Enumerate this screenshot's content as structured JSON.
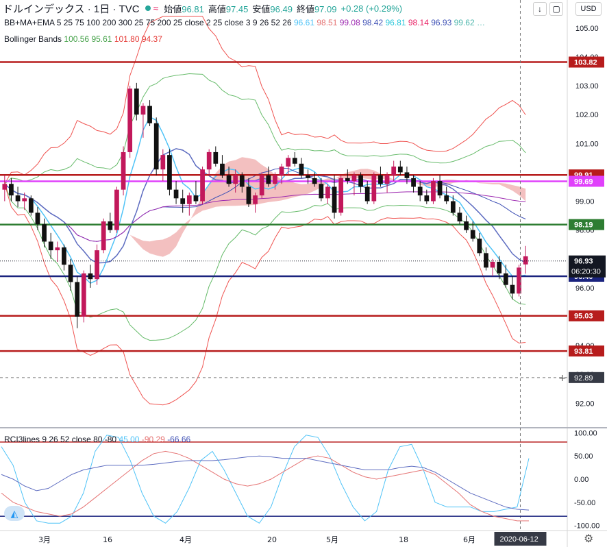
{
  "header": {
    "symbol": "ドルインデックス · 1日 · TVC",
    "ohlc": [
      {
        "label": "始値",
        "value": "96.81"
      },
      {
        "label": "高値",
        "value": "97.45"
      },
      {
        "label": "安値",
        "value": "96.49"
      },
      {
        "label": "終値",
        "value": "97.09"
      }
    ],
    "change": "+0.28 (+0.29%)",
    "currency": "USD"
  },
  "indicators": {
    "bbma": {
      "label": "BB+MA+EMA 5 25 75 100 200 300 25 75 200 25 close 2 25 close 3 9 26 52 26",
      "values": [
        {
          "v": "96.61",
          "color": "#4fc3f7"
        },
        {
          "v": "98.51",
          "color": "#e57373"
        },
        {
          "v": "99.08",
          "color": "#9c27b0"
        },
        {
          "v": "98.42",
          "color": "#3f51b5"
        },
        {
          "v": "96.81",
          "color": "#26c6da"
        },
        {
          "v": "98.14",
          "color": "#e91e63"
        },
        {
          "v": "96.93",
          "color": "#3f51b5"
        },
        {
          "v": "99.62",
          "color": "#4db6ac"
        },
        {
          "v": "…",
          "color": "#4db6ac"
        }
      ]
    },
    "bollinger": {
      "label": "Bollinger Bands",
      "values": [
        {
          "v": "100.56",
          "color": "#43a047"
        },
        {
          "v": "95.61",
          "color": "#43a047"
        },
        {
          "v": "101.80",
          "color": "#e53935"
        },
        {
          "v": "94.37",
          "color": "#e53935"
        }
      ]
    },
    "rci": {
      "label": "RCI3lines 9 26 52 close 80 -80",
      "values": [
        {
          "v": "45.00",
          "color": "#4fc3f7"
        },
        {
          "v": "-90.29",
          "color": "#e57373"
        },
        {
          "v": "-66.66",
          "color": "#3f51b5"
        }
      ]
    }
  },
  "chart_data": {
    "type": "candlestick",
    "price_axis": {
      "ticks": [
        "105.00",
        "104.00",
        "103.00",
        "102.00",
        "101.00",
        "100.00",
        "99.00",
        "98.00",
        "97.00",
        "96.00",
        "95.00",
        "94.00",
        "93.00",
        "92.00"
      ],
      "range": [
        91.2,
        105.4
      ]
    },
    "x_axis": {
      "labels": [
        "3月",
        "16",
        "4月",
        "20",
        "5月",
        "18",
        "6月"
      ],
      "cursor_date": "2020-06-12"
    },
    "horizontal_lines": [
      {
        "value": 103.82,
        "label": "103.82",
        "color": "#b71c1c"
      },
      {
        "value": 99.91,
        "label": "99.91",
        "color": "#b71c1c"
      },
      {
        "value": 99.69,
        "label": "99.69",
        "color": "#e040fb"
      },
      {
        "value": 98.19,
        "label": "98.19",
        "color": "#2e7d32"
      },
      {
        "value": 96.4,
        "label": "96.40",
        "color": "#1a237e"
      },
      {
        "value": 95.03,
        "label": "95.03",
        "color": "#b71c1c"
      },
      {
        "value": 93.81,
        "label": "93.81",
        "color": "#b71c1c"
      }
    ],
    "last_price": {
      "value": 96.93,
      "label": "96.93",
      "countdown": "06:20:30"
    },
    "crosshair_price": {
      "value": 92.89,
      "label": "92.89"
    },
    "candles": [
      [
        99.4,
        99.9,
        99.0,
        99.6
      ],
      [
        99.6,
        99.8,
        99.0,
        99.2
      ],
      [
        99.2,
        99.5,
        98.8,
        99.0
      ],
      [
        99.0,
        99.3,
        98.7,
        99.1
      ],
      [
        99.1,
        99.2,
        98.5,
        98.6
      ],
      [
        98.6,
        98.8,
        98.0,
        98.2
      ],
      [
        98.2,
        98.4,
        97.4,
        97.6
      ],
      [
        97.6,
        97.9,
        97.0,
        97.3
      ],
      [
        97.3,
        97.6,
        96.9,
        97.4
      ],
      [
        97.4,
        97.5,
        96.6,
        96.8
      ],
      [
        96.8,
        97.0,
        95.9,
        96.2
      ],
      [
        96.2,
        96.4,
        94.6,
        95.0
      ],
      [
        95.0,
        96.6,
        94.8,
        96.5
      ],
      [
        96.5,
        96.8,
        96.0,
        96.3
      ],
      [
        96.3,
        97.5,
        96.1,
        97.3
      ],
      [
        97.3,
        98.4,
        97.2,
        98.3
      ],
      [
        98.3,
        98.6,
        97.9,
        98.0
      ],
      [
        98.0,
        99.5,
        97.9,
        99.4
      ],
      [
        99.4,
        100.9,
        99.2,
        100.7
      ],
      [
        100.7,
        103.0,
        100.5,
        102.9
      ],
      [
        102.9,
        103.1,
        101.8,
        102.0
      ],
      [
        102.0,
        102.4,
        101.2,
        102.3
      ],
      [
        102.3,
        102.5,
        101.6,
        101.7
      ],
      [
        101.7,
        101.9,
        99.9,
        100.1
      ],
      [
        100.1,
        100.8,
        99.7,
        100.6
      ],
      [
        100.6,
        100.8,
        99.2,
        99.4
      ],
      [
        99.4,
        99.7,
        98.9,
        99.1
      ],
      [
        99.1,
        99.4,
        98.6,
        98.9
      ],
      [
        98.9,
        99.3,
        98.5,
        99.2
      ],
      [
        99.2,
        99.7,
        98.9,
        99.0
      ],
      [
        99.0,
        100.2,
        98.9,
        100.1
      ],
      [
        100.1,
        100.8,
        99.9,
        100.7
      ],
      [
        100.7,
        100.9,
        100.2,
        100.3
      ],
      [
        100.3,
        100.6,
        99.8,
        99.9
      ],
      [
        99.9,
        100.2,
        99.5,
        99.6
      ],
      [
        99.6,
        100.1,
        99.3,
        99.9
      ],
      [
        99.9,
        100.0,
        99.3,
        99.5
      ],
      [
        99.5,
        99.8,
        98.8,
        98.9
      ],
      [
        98.9,
        99.3,
        98.6,
        99.2
      ],
      [
        99.2,
        100.0,
        99.1,
        99.9
      ],
      [
        99.9,
        100.2,
        99.5,
        99.6
      ],
      [
        99.6,
        100.0,
        99.4,
        99.9
      ],
      [
        99.9,
        100.3,
        99.6,
        100.2
      ],
      [
        100.2,
        100.6,
        99.9,
        100.5
      ],
      [
        100.5,
        100.7,
        100.2,
        100.3
      ],
      [
        100.3,
        100.5,
        99.8,
        99.9
      ],
      [
        99.9,
        100.1,
        99.6,
        99.8
      ],
      [
        99.8,
        100.0,
        99.5,
        99.6
      ],
      [
        99.6,
        99.8,
        99.0,
        99.1
      ],
      [
        99.1,
        99.6,
        98.9,
        99.5
      ],
      [
        99.5,
        99.9,
        98.4,
        98.6
      ],
      [
        98.6,
        99.9,
        98.5,
        99.8
      ],
      [
        99.8,
        100.1,
        99.6,
        99.7
      ],
      [
        99.7,
        100.0,
        99.2,
        99.9
      ],
      [
        99.9,
        100.0,
        99.3,
        99.5
      ],
      [
        99.5,
        99.7,
        98.9,
        99.0
      ],
      [
        99.0,
        100.0,
        98.9,
        99.9
      ],
      [
        99.9,
        100.2,
        99.5,
        99.6
      ],
      [
        99.6,
        100.0,
        99.3,
        99.9
      ],
      [
        99.9,
        100.4,
        99.7,
        100.2
      ],
      [
        100.2,
        100.4,
        99.9,
        100.0
      ],
      [
        100.0,
        100.2,
        99.6,
        99.8
      ],
      [
        99.8,
        99.9,
        99.3,
        99.5
      ],
      [
        99.5,
        99.7,
        99.0,
        99.2
      ],
      [
        99.2,
        99.4,
        98.9,
        99.0
      ],
      [
        99.0,
        99.8,
        98.9,
        99.7
      ],
      [
        99.7,
        99.9,
        99.1,
        99.2
      ],
      [
        99.2,
        99.5,
        98.9,
        99.0
      ],
      [
        99.0,
        99.2,
        98.5,
        98.6
      ],
      [
        98.6,
        98.8,
        98.2,
        98.3
      ],
      [
        98.3,
        98.5,
        97.9,
        98.0
      ],
      [
        98.0,
        98.3,
        97.6,
        97.7
      ],
      [
        97.7,
        97.9,
        97.1,
        97.2
      ],
      [
        97.2,
        97.4,
        96.6,
        96.7
      ],
      [
        96.7,
        97.0,
        96.4,
        96.9
      ],
      [
        96.9,
        97.1,
        96.3,
        96.5
      ],
      [
        96.5,
        96.8,
        96.0,
        96.1
      ],
      [
        96.1,
        96.4,
        95.6,
        95.8
      ],
      [
        95.8,
        96.8,
        95.7,
        96.7
      ],
      [
        96.81,
        97.45,
        96.49,
        97.09
      ]
    ],
    "rci_axis": {
      "ticks": [
        "100.00",
        "50.00",
        "0.00",
        "-50.00",
        "-100.00"
      ],
      "range": [
        -105,
        105
      ]
    },
    "rci_levels": [
      80,
      -80
    ],
    "rci_series": [
      {
        "values": [
          70,
          30,
          -50,
          -90,
          -95,
          -95,
          -80,
          -30,
          60,
          95,
          90,
          40,
          -30,
          -80,
          -95,
          -70,
          -20,
          40,
          60,
          20,
          -30,
          -80,
          -95,
          -60,
          10,
          70,
          95,
          90,
          50,
          -10,
          -60,
          -90,
          -70,
          20,
          70,
          75,
          20,
          -50,
          -60,
          -60,
          -60,
          -70,
          -70,
          -65,
          -60,
          45
        ]
      },
      {
        "values": [
          -30,
          -50,
          -60,
          -70,
          -75,
          -80,
          -75,
          -60,
          -40,
          -20,
          0,
          20,
          40,
          55,
          60,
          55,
          45,
          30,
          15,
          0,
          -10,
          -15,
          -10,
          0,
          15,
          30,
          45,
          50,
          45,
          30,
          15,
          5,
          0,
          5,
          10,
          15,
          20,
          10,
          -10,
          -30,
          -55,
          -70,
          -80,
          -85,
          -90,
          -90
        ]
      },
      {
        "values": [
          10,
          0,
          -15,
          -25,
          -20,
          -5,
          10,
          20,
          25,
          30,
          30,
          30,
          30,
          32,
          35,
          38,
          40,
          40,
          40,
          42,
          45,
          48,
          50,
          48,
          45,
          45,
          45,
          40,
          35,
          30,
          25,
          20,
          20,
          20,
          25,
          28,
          25,
          15,
          0,
          -15,
          -30,
          -40,
          -50,
          -60,
          -65,
          -66.66
        ]
      }
    ]
  }
}
